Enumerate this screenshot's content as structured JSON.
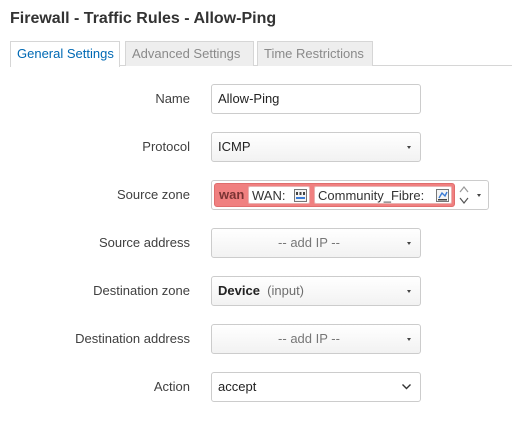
{
  "page": {
    "title": "Firewall - Traffic Rules - Allow-Ping"
  },
  "tabs": [
    {
      "label": "General Settings",
      "active": true
    },
    {
      "label": "Advanced Settings",
      "active": false
    },
    {
      "label": "Time Restrictions",
      "active": false
    }
  ],
  "form": {
    "name": {
      "label": "Name",
      "value": "Allow-Ping"
    },
    "protocol": {
      "label": "Protocol",
      "value": "ICMP"
    },
    "source_zone": {
      "label": "Source zone",
      "zone": "wan",
      "interfaces": [
        "WAN:",
        "Community_Fibre:"
      ]
    },
    "source_address": {
      "label": "Source address",
      "value": "-- add IP --"
    },
    "destination_zone": {
      "label": "Destination zone",
      "value": "Device",
      "suffix": "(input)"
    },
    "destination_address": {
      "label": "Destination address",
      "value": "-- add IP --"
    },
    "action": {
      "label": "Action",
      "value": "accept"
    }
  },
  "colors": {
    "accent": "#0069b4",
    "zone_wan": "#f08080"
  },
  "icons": {
    "interface": "network-interface-icon",
    "dropdown": "caret-down-icon"
  }
}
